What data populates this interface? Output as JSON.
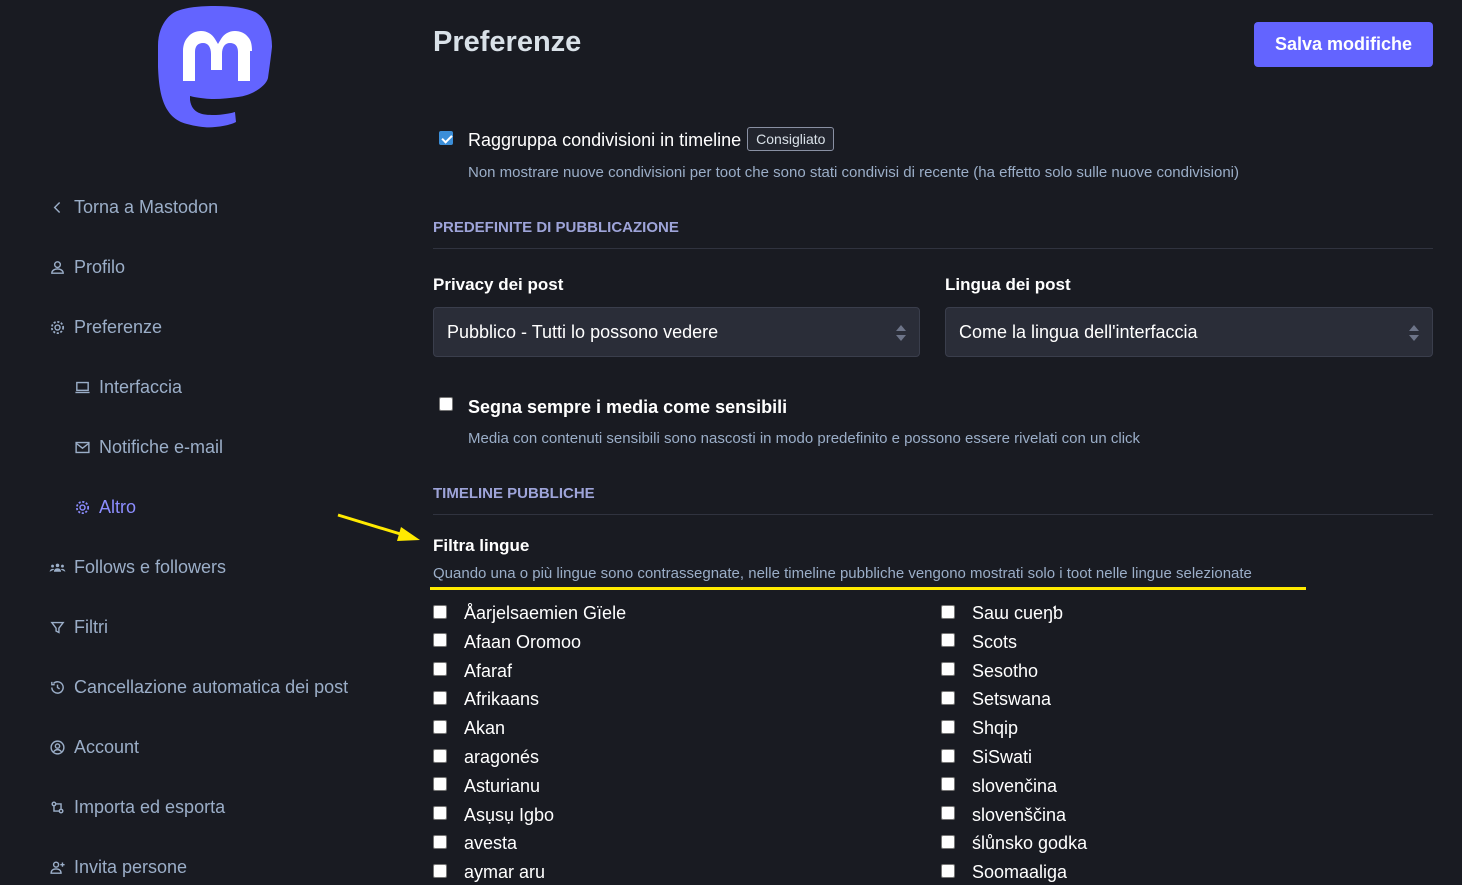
{
  "sidebar": {
    "items": [
      {
        "label": "Torna a Mastodon",
        "icon": "chevron-left-icon"
      },
      {
        "label": "Profilo",
        "icon": "person-icon"
      },
      {
        "label": "Preferenze",
        "icon": "gear-icon"
      },
      {
        "label": "Interfaccia",
        "icon": "laptop-icon"
      },
      {
        "label": "Notifiche e-mail",
        "icon": "mail-icon"
      },
      {
        "label": "Altro",
        "icon": "gear-icon"
      },
      {
        "label": "Follows e followers",
        "icon": "group-icon"
      },
      {
        "label": "Filtri",
        "icon": "filter-icon"
      },
      {
        "label": "Cancellazione automatica dei post",
        "icon": "history-icon"
      },
      {
        "label": "Account",
        "icon": "account-circle-icon"
      },
      {
        "label": "Importa ed esporta",
        "icon": "import-export-icon"
      },
      {
        "label": "Invita persone",
        "icon": "person-add-icon"
      }
    ]
  },
  "header": {
    "title": "Preferenze",
    "save_label": "Salva modifiche"
  },
  "group_boosts": {
    "label": "Raggruppa condivisioni in timeline",
    "badge": "Consigliato",
    "hint": "Non mostrare nuove condivisioni per toot che sono stati condivisi di recente (ha effetto solo sulle nuove condivisioni)",
    "checked": true
  },
  "posting_defaults": {
    "heading": "PREDEFINITE DI PUBBLICAZIONE",
    "privacy_label": "Privacy dei post",
    "privacy_value": "Pubblico - Tutti lo possono vedere",
    "language_label": "Lingua dei post",
    "language_value": "Come la lingua dell'interfaccia",
    "sensitive_label": "Segna sempre i media come sensibili",
    "sensitive_hint": "Media con contenuti sensibili sono nascosti in modo predefinito e possono essere rivelati con un click",
    "sensitive_checked": false
  },
  "public_timelines": {
    "heading": "TIMELINE PUBBLICHE",
    "filter_label": "Filtra lingue",
    "filter_hint": "Quando una o più lingue sono contrassegnate, nelle timeline pubbliche vengono mostrati solo i toot nelle lingue selezionate",
    "languages_left": [
      "Åarjelsaemien Gïele",
      "Afaan Oromoo",
      "Afaraf",
      "Afrikaans",
      "Akan",
      "aragonés",
      "Asturianu",
      "Asụsụ Igbo",
      "avesta",
      "aymar aru"
    ],
    "languages_right": [
      "Saɯ cueŋƅ",
      "Scots",
      "Sesotho",
      "Setswana",
      "Shqip",
      "SiSwati",
      "slovenčina",
      "slovenščina",
      "ślůnsko godka",
      "Soomaaliga"
    ]
  },
  "colors": {
    "accent": "#6364ff",
    "background": "#191b22",
    "annotation": "#ffea00"
  }
}
